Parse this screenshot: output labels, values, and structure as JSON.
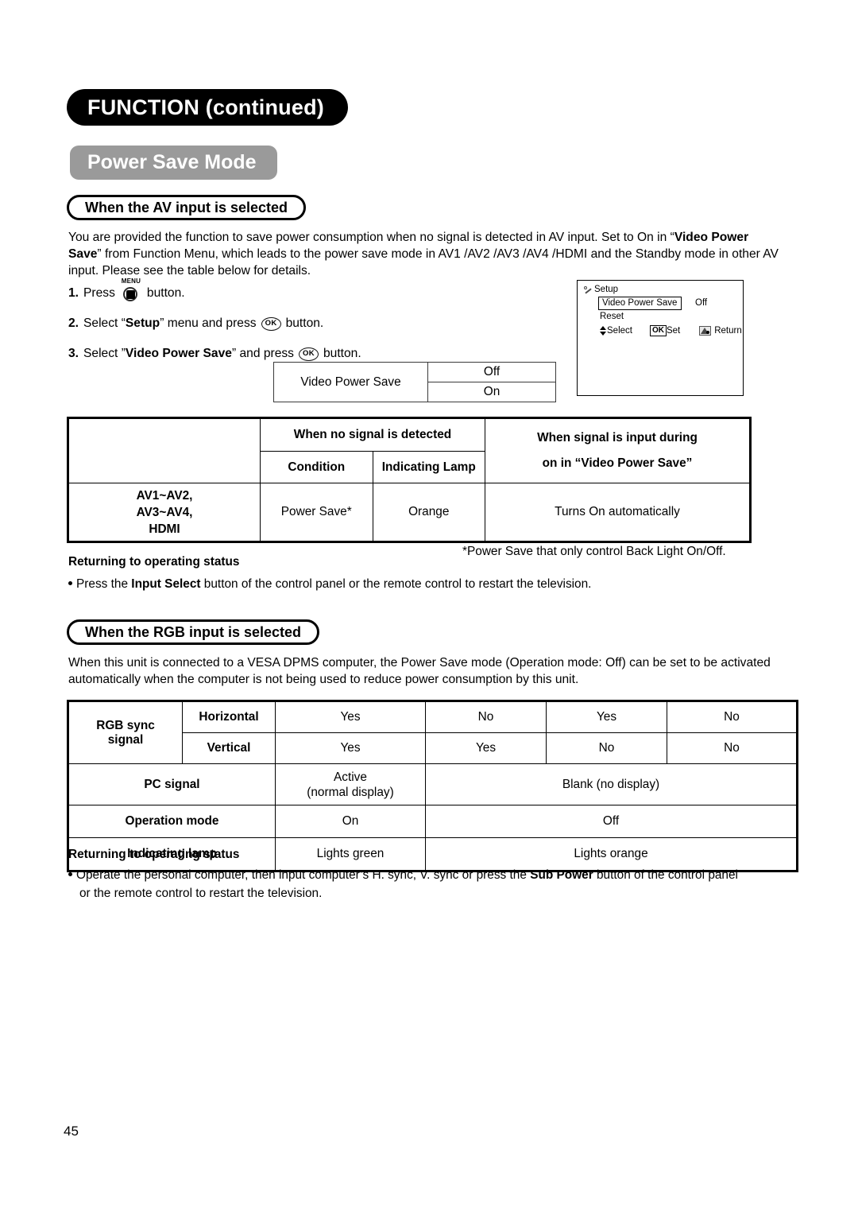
{
  "header": {
    "chapter_title": "FUNCTION (continued)",
    "section_title": "Power Save Mode"
  },
  "av_section": {
    "sub_heading": "When the AV input is selected",
    "intro_part1": "You are provided the function to save power consumption when no signal is detected in AV input. Set to On in “",
    "intro_bold1": "Video Power Save",
    "intro_part2": "” from Function Menu, which leads to the power save mode in AV1 /AV2 /AV3 /AV4 /HDMI and the Standby mode in other AV input. Please see the table below for details.",
    "steps": [
      {
        "num": "1.",
        "text_before": "Press",
        "icon": "menu-button-icon",
        "icon_label": "MENU",
        "text_after": "button."
      },
      {
        "num": "2.",
        "text_before": "Select “",
        "bold": "Setup",
        "text_mid": "” menu and press",
        "icon": "ok-button-icon",
        "icon_label": "OK",
        "text_after": "button."
      },
      {
        "num": "3.",
        "text_before": "Select ”",
        "bold": "Video Power Save",
        "text_mid": "” and press",
        "icon": "ok-button-icon",
        "icon_label": "OK",
        "text_after": "button."
      }
    ],
    "vps_table": {
      "label": "Video Power Save",
      "options": [
        "Off",
        "On"
      ]
    },
    "osd": {
      "title": "Setup",
      "item_highlighted": "Video Power Save",
      "item_value": "Off",
      "item_second": "Reset",
      "legend_select": "Select",
      "legend_ok": "OK",
      "legend_set": "Set",
      "legend_return": "Return"
    },
    "table": {
      "group_header_nosignal": "When no signal is detected",
      "group_header_during_line1": "When signal is input during",
      "group_header_during_line2": "on in “Video Power Save”",
      "sub_header_condition": "Condition",
      "sub_header_lamp": "Indicating Lamp",
      "row": {
        "inputs_line1": "AV1~AV2,",
        "inputs_line2": "AV3~AV4,",
        "inputs_line3": "HDMI",
        "condition": "Power Save*",
        "lamp": "Orange",
        "during": "Turns On automatically"
      }
    },
    "footnote": "*Power Save that only control Back Light On/Off.",
    "returning_heading": "Returning to operating status",
    "returning_bullet_before": "Press the ",
    "returning_bullet_bold": "Input Select",
    "returning_bullet_after": " button of the control panel or the remote control to restart the television."
  },
  "rgb_section": {
    "sub_heading": "When the RGB input is selected",
    "intro": "When this unit is connected to a VESA DPMS computer, the Power Save mode (Operation mode: Off) can be set to be activated automatically when the computer is not being used to reduce power consumption by this unit.",
    "table": {
      "rgb_sync_line1": "RGB sync",
      "rgb_sync_line2": "signal",
      "horizontal_label": "Horizontal",
      "vertical_label": "Vertical",
      "horizontal_values": [
        "Yes",
        "No",
        "Yes",
        "No"
      ],
      "vertical_values": [
        "Yes",
        "Yes",
        "No",
        "No"
      ],
      "pc_signal_label": "PC signal",
      "pc_signal_active_line1": "Active",
      "pc_signal_active_line2": "(normal display)",
      "pc_signal_blank": "Blank (no display)",
      "operation_mode_label": "Operation mode",
      "operation_mode_on": "On",
      "operation_mode_off": "Off",
      "indicating_lamp_label": "Indicating lamp",
      "indicating_lamp_green": "Lights green",
      "indicating_lamp_orange": "Lights orange"
    },
    "returning_heading": "Returning to operating status",
    "returning_bullet_before": "Operate the personal computer, then input computer’s H. sync, V. sync or press the ",
    "returning_bullet_bold": "Sub Power",
    "returning_bullet_after": " button of the control panel",
    "returning_bullet_line2": "or the remote control to restart the television."
  },
  "footer": {
    "page_number": "45"
  },
  "colors": {
    "chapter_pill_bg": "#000000",
    "section_pill_bg": "#9a9a9a",
    "text": "#000000",
    "page_bg": "#ffffff"
  }
}
